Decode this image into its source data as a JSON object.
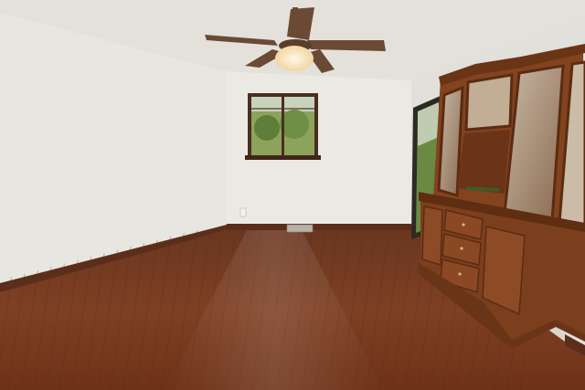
{
  "scene": {
    "subject": "empty-dining-room",
    "elements": [
      "ceiling-fan",
      "window",
      "sliding-glass-door",
      "china-cabinet",
      "hardwood-floor",
      "floor-vent",
      "wall-outlet"
    ]
  },
  "colors": {
    "ceiling": "#e6e3dd",
    "left_wall": "#e7e5e0",
    "back_wall": "#e9e7e2",
    "right_wall": "#e3e1db",
    "floor": "#7c3e22",
    "baseboard": "#5a2e1c",
    "cabinet": "#7a3f1f",
    "window_frame": "#4a2e20",
    "fan_blade": "#6b4a35",
    "fan_light": "#fbe9c4"
  }
}
